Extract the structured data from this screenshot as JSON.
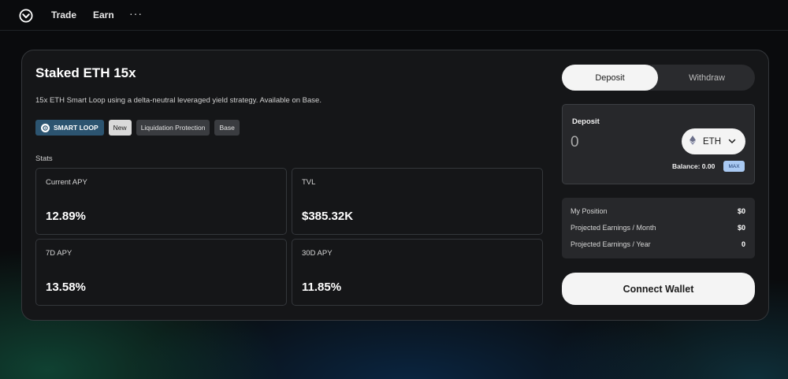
{
  "nav": {
    "logo_icon": "vault-logo-icon",
    "items": [
      {
        "label": "Trade"
      },
      {
        "label": "Earn"
      }
    ],
    "more_label": "···"
  },
  "vault": {
    "title": "Staked ETH 15x",
    "description": "15x ETH Smart Loop using a delta-neutral leveraged yield strategy. Available on Base.",
    "tags": {
      "smart_loop": "SMART LOOP",
      "new": "New",
      "liquidation": "Liquidation Protection",
      "network": "Base"
    },
    "stats_heading": "Stats",
    "stats": [
      {
        "label": "Current APY",
        "value": "12.89%"
      },
      {
        "label": "TVL",
        "value": "$385.32K"
      },
      {
        "label": "7D APY",
        "value": "13.58%"
      },
      {
        "label": "30D APY",
        "value": "11.85%"
      }
    ]
  },
  "panel": {
    "tabs": {
      "deposit": "Deposit",
      "withdraw": "Withdraw"
    },
    "deposit": {
      "label": "Deposit",
      "placeholder": "0",
      "token": "ETH",
      "balance": "Balance: 0.00",
      "max_label": "MAX"
    },
    "position": {
      "rows": [
        {
          "label": "My Position",
          "value": "$0"
        },
        {
          "label": "Projected Earnings / Month",
          "value": "$0"
        },
        {
          "label": "Projected Earnings / Year",
          "value": "0"
        }
      ]
    },
    "connect_label": "Connect Wallet"
  },
  "colors": {
    "background": "#0a0b0d",
    "card": "#151618",
    "smart_loop_tag": "#2c5470",
    "max_badge": "#a9c9f2",
    "button": "#f4f4f4"
  }
}
